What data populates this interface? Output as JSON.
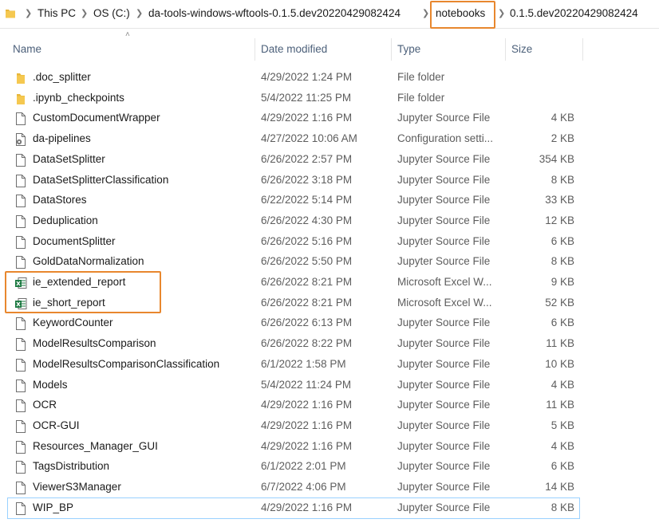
{
  "breadcrumb": [
    "This PC",
    "OS (C:)",
    "da-tools-windows-wftools-0.1.5.dev20220429082424",
    "notebooks",
    "0.1.5.dev20220429082424"
  ],
  "columns": {
    "name": "Name",
    "date": "Date modified",
    "type": "Type",
    "size": "Size"
  },
  "colors": {
    "highlight": "#e8872e",
    "folder": "#e8b73b",
    "excel": "#1d7a42"
  },
  "files": [
    {
      "name": ".doc_splitter",
      "date": "4/29/2022 1:24 PM",
      "type": "File folder",
      "size": "",
      "icon": "folder-icon"
    },
    {
      "name": ".ipynb_checkpoints",
      "date": "5/4/2022 11:25 PM",
      "type": "File folder",
      "size": "",
      "icon": "folder-icon"
    },
    {
      "name": "CustomDocumentWrapper",
      "date": "4/29/2022 1:16 PM",
      "type": "Jupyter Source File",
      "size": "4 KB",
      "icon": "document-icon"
    },
    {
      "name": "da-pipelines",
      "date": "4/27/2022 10:06 AM",
      "type": "Configuration setti...",
      "size": "2 KB",
      "icon": "config-file-icon"
    },
    {
      "name": "DataSetSplitter",
      "date": "6/26/2022 2:57 PM",
      "type": "Jupyter Source File",
      "size": "354 KB",
      "icon": "document-icon"
    },
    {
      "name": "DataSetSplitterClassification",
      "date": "6/26/2022 3:18 PM",
      "type": "Jupyter Source File",
      "size": "8 KB",
      "icon": "document-icon"
    },
    {
      "name": "DataStores",
      "date": "6/22/2022 5:14 PM",
      "type": "Jupyter Source File",
      "size": "33 KB",
      "icon": "document-icon"
    },
    {
      "name": "Deduplication",
      "date": "6/26/2022 4:30 PM",
      "type": "Jupyter Source File",
      "size": "12 KB",
      "icon": "document-icon"
    },
    {
      "name": "DocumentSplitter",
      "date": "6/26/2022 5:16 PM",
      "type": "Jupyter Source File",
      "size": "6 KB",
      "icon": "document-icon"
    },
    {
      "name": "GoldDataNormalization",
      "date": "6/26/2022 5:50 PM",
      "type": "Jupyter Source File",
      "size": "8 KB",
      "icon": "document-icon"
    },
    {
      "name": "ie_extended_report",
      "date": "6/26/2022 8:21 PM",
      "type": "Microsoft Excel W...",
      "size": "9 KB",
      "icon": "excel-icon"
    },
    {
      "name": "ie_short_report",
      "date": "6/26/2022 8:21 PM",
      "type": "Microsoft Excel W...",
      "size": "52 KB",
      "icon": "excel-icon"
    },
    {
      "name": "KeywordCounter",
      "date": "6/26/2022 6:13 PM",
      "type": "Jupyter Source File",
      "size": "6 KB",
      "icon": "document-icon"
    },
    {
      "name": "ModelResultsComparison",
      "date": "6/26/2022 8:22 PM",
      "type": "Jupyter Source File",
      "size": "11 KB",
      "icon": "document-icon"
    },
    {
      "name": "ModelResultsComparisonClassification",
      "date": "6/1/2022 1:58 PM",
      "type": "Jupyter Source File",
      "size": "10 KB",
      "icon": "document-icon"
    },
    {
      "name": "Models",
      "date": "5/4/2022 11:24 PM",
      "type": "Jupyter Source File",
      "size": "4 KB",
      "icon": "document-icon"
    },
    {
      "name": "OCR",
      "date": "4/29/2022 1:16 PM",
      "type": "Jupyter Source File",
      "size": "11 KB",
      "icon": "document-icon"
    },
    {
      "name": "OCR-GUI",
      "date": "4/29/2022 1:16 PM",
      "type": "Jupyter Source File",
      "size": "5 KB",
      "icon": "document-icon"
    },
    {
      "name": "Resources_Manager_GUI",
      "date": "4/29/2022 1:16 PM",
      "type": "Jupyter Source File",
      "size": "4 KB",
      "icon": "document-icon"
    },
    {
      "name": "TagsDistribution",
      "date": "6/1/2022 2:01 PM",
      "type": "Jupyter Source File",
      "size": "6 KB",
      "icon": "document-icon"
    },
    {
      "name": "ViewerS3Manager",
      "date": "6/7/2022 4:06 PM",
      "type": "Jupyter Source File",
      "size": "14 KB",
      "icon": "document-icon"
    },
    {
      "name": "WIP_BP",
      "date": "4/29/2022 1:16 PM",
      "type": "Jupyter Source File",
      "size": "8 KB",
      "icon": "document-icon",
      "selected": true
    }
  ]
}
